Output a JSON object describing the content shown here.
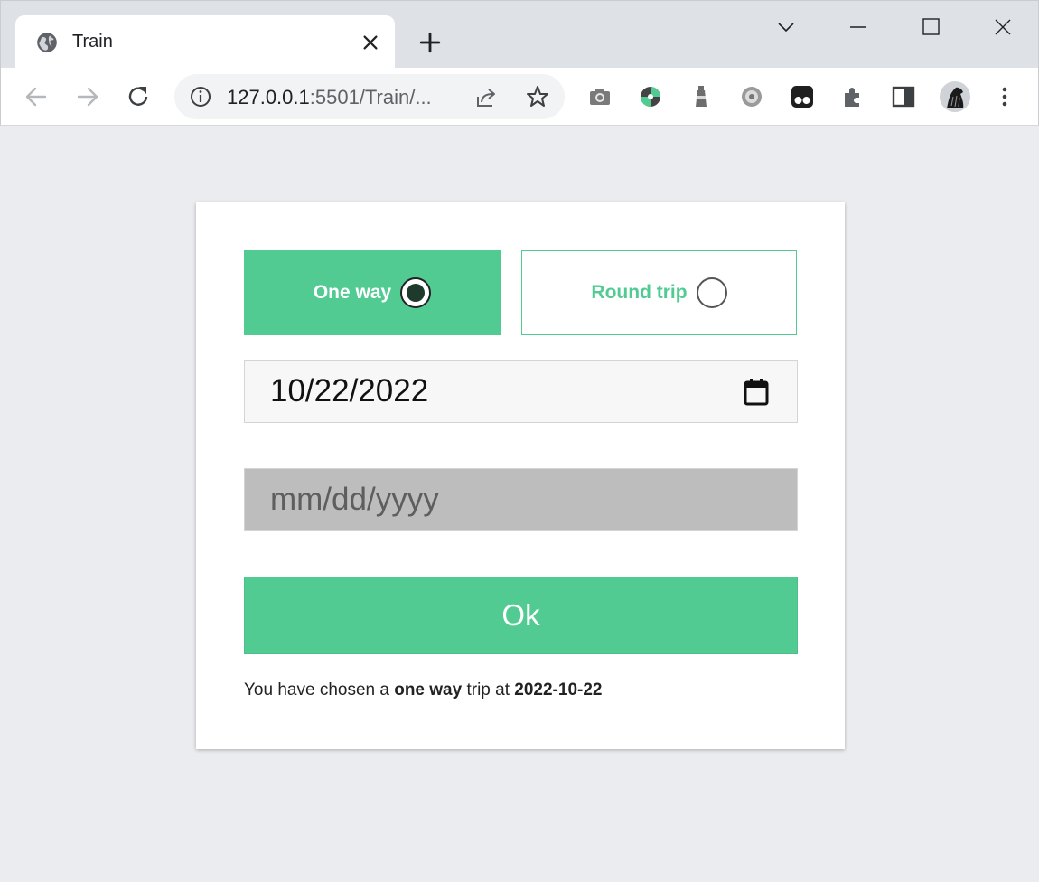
{
  "browser": {
    "tab": {
      "title": "Train"
    },
    "url": {
      "host": "127.0.0.1",
      "rest": ":5501/Train/..."
    }
  },
  "form": {
    "trip_options": [
      {
        "label": "One way",
        "checked": true
      },
      {
        "label": "Round trip",
        "checked": false
      }
    ],
    "departure_date": "10/22/2022",
    "return_date_placeholder": "mm/dd/yyyy",
    "ok_label": "Ok"
  },
  "summary": {
    "prefix": "You have chosen a ",
    "trip_type": "one way",
    "middle": " trip at ",
    "date": "2022-10-22"
  },
  "colors": {
    "accent": "#52cb93",
    "disabled_field": "#bdbdbd",
    "page_background": "#ebecef"
  }
}
